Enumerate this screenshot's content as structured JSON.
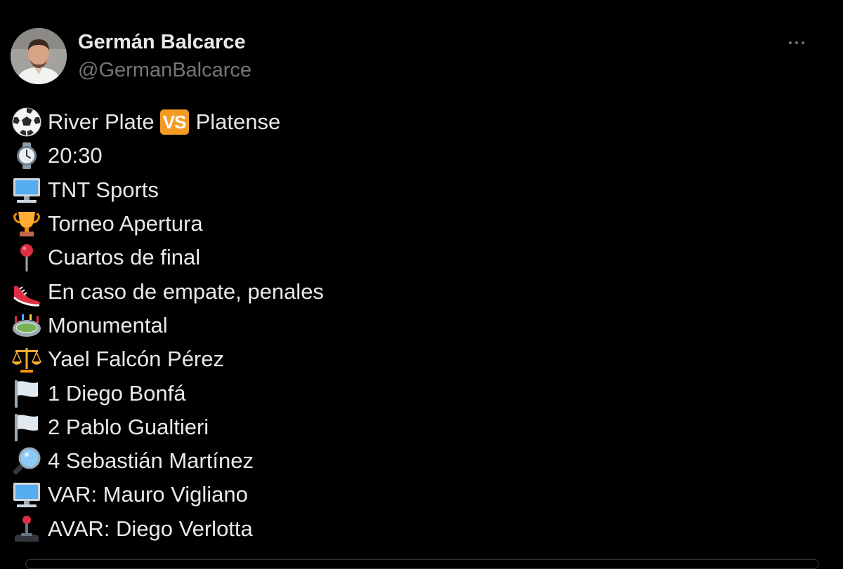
{
  "author": {
    "name": "Germán Balcarce",
    "handle": "@GermanBalcarce"
  },
  "tweet": {
    "match": {
      "home": "River Plate",
      "vs_label": "VS",
      "away": "Platense"
    },
    "lines": [
      {
        "icon": "clock-icon",
        "text": "20:30"
      },
      {
        "icon": "computer-icon",
        "text": "TNT Sports"
      },
      {
        "icon": "trophy-icon",
        "text": "Torneo Apertura"
      },
      {
        "icon": "pin-icon",
        "text": "Cuartos de final"
      },
      {
        "icon": "shoe-icon",
        "text": "En caso de empate, penales"
      },
      {
        "icon": "stadium-icon",
        "text": "Monumental"
      },
      {
        "icon": "scales-icon",
        "text": " Yael Falcón Pérez"
      },
      {
        "icon": "white-flag-icon",
        "text": "1 Diego Bonfá"
      },
      {
        "icon": "white-flag-icon",
        "text": "2 Pablo Gualtieri"
      },
      {
        "icon": "magnifier-icon",
        "text": "4 Sebastián Martínez"
      },
      {
        "icon": "computer-icon",
        "text": "VAR: Mauro Vigliano"
      },
      {
        "icon": "joystick-icon",
        "text": "AVAR: Diego Verlotta"
      }
    ]
  },
  "colors": {
    "background": "#000000",
    "text": "#e7e9ea",
    "secondary_text": "#71767b",
    "vs_badge": "#f49b24"
  }
}
